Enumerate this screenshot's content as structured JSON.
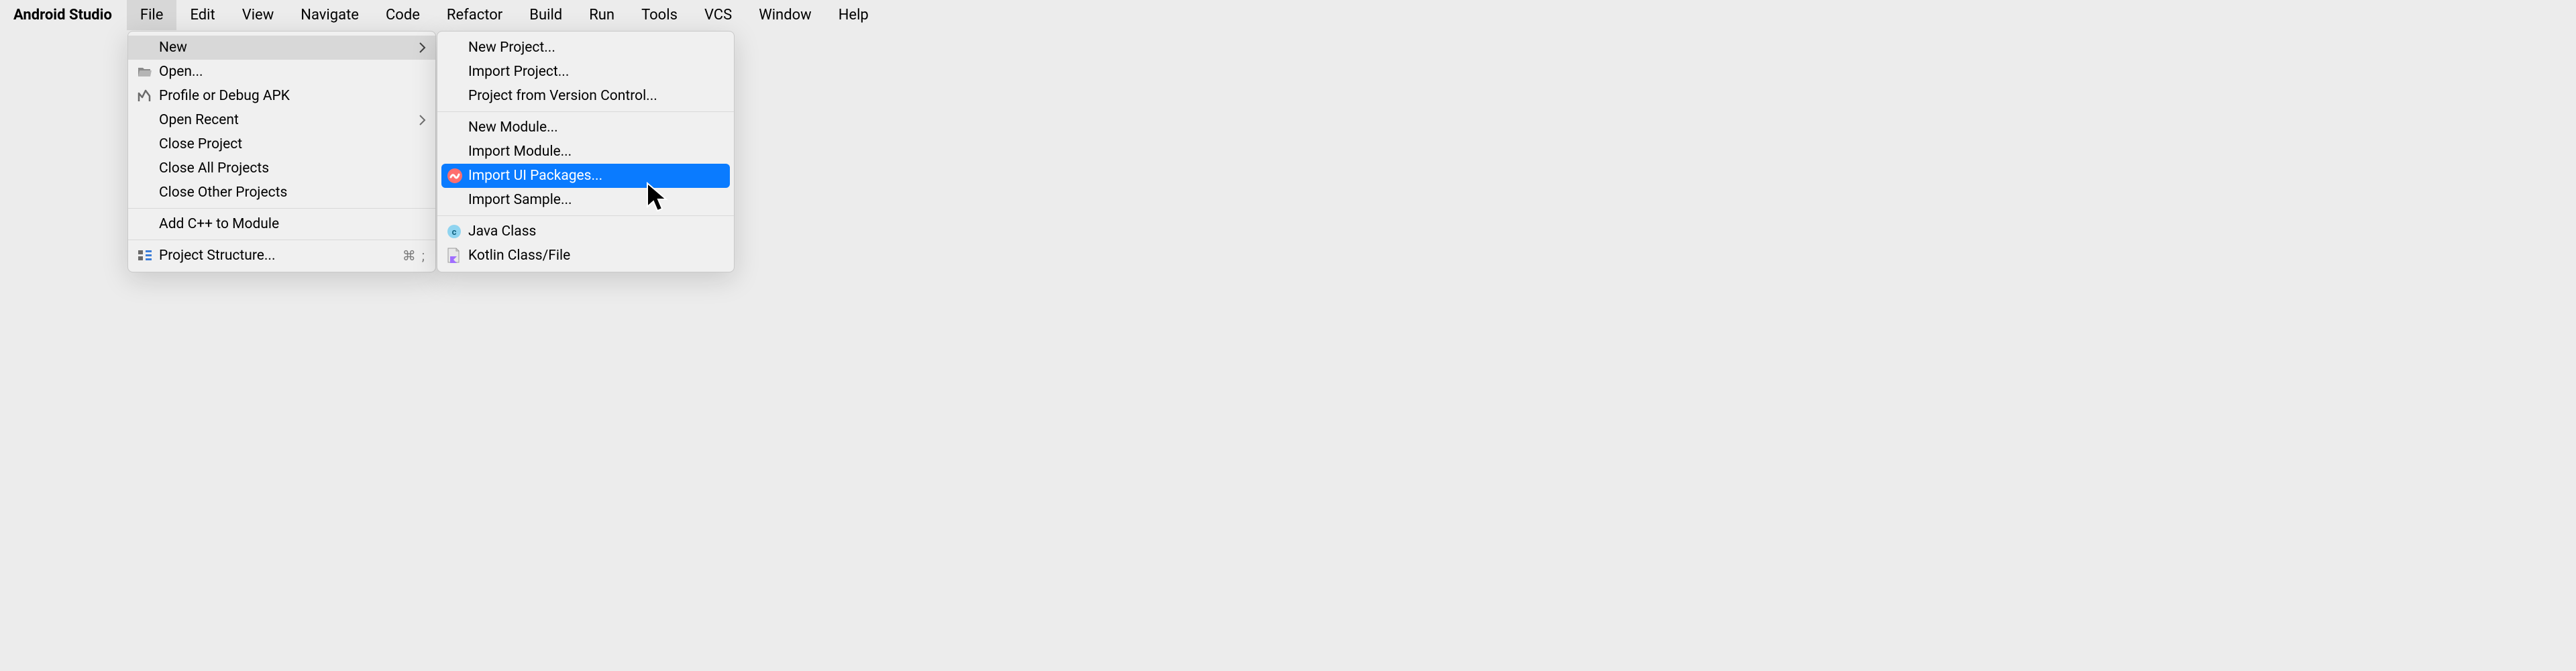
{
  "app_name": "Android Studio",
  "menubar": {
    "items": [
      {
        "label": "File",
        "active": true
      },
      {
        "label": "Edit"
      },
      {
        "label": "View"
      },
      {
        "label": "Navigate"
      },
      {
        "label": "Code"
      },
      {
        "label": "Refactor"
      },
      {
        "label": "Build"
      },
      {
        "label": "Run"
      },
      {
        "label": "Tools"
      },
      {
        "label": "VCS"
      },
      {
        "label": "Window"
      },
      {
        "label": "Help"
      }
    ]
  },
  "file_menu": {
    "items": [
      {
        "label": "New",
        "submenu": true,
        "hovered": true
      },
      {
        "label": "Open...",
        "icon": "folder-open-icon"
      },
      {
        "label": "Profile or Debug APK",
        "icon": "profile-icon"
      },
      {
        "label": "Open Recent",
        "submenu": true
      },
      {
        "label": "Close Project"
      },
      {
        "label": "Close All Projects"
      },
      {
        "label": "Close Other Projects"
      },
      {
        "sep": true
      },
      {
        "label": "Add C++ to Module"
      },
      {
        "sep": true
      },
      {
        "label": "Project Structure...",
        "icon": "structure-icon",
        "shortcut": "⌘ ;"
      }
    ]
  },
  "new_menu": {
    "items": [
      {
        "label": "New Project..."
      },
      {
        "label": "Import Project..."
      },
      {
        "label": "Project from Version Control..."
      },
      {
        "sep": true
      },
      {
        "label": "New Module..."
      },
      {
        "label": "Import Module..."
      },
      {
        "label": "Import UI Packages...",
        "icon": "relay-icon",
        "highlighted": true
      },
      {
        "label": "Import Sample..."
      },
      {
        "sep": true
      },
      {
        "label": "Java Class",
        "icon": "java-class-icon"
      },
      {
        "label": "Kotlin Class/File",
        "icon": "kotlin-file-icon"
      }
    ]
  }
}
